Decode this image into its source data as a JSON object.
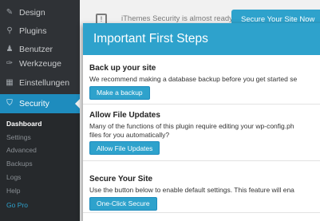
{
  "sidebar": {
    "items": [
      {
        "label": "Design",
        "icon": "paintbrush-icon"
      },
      {
        "label": "Plugins",
        "icon": "plugin-icon"
      },
      {
        "label": "Benutzer",
        "icon": "users-icon"
      },
      {
        "label": "Werkzeuge",
        "icon": "wrench-icon"
      },
      {
        "label": "Einstellungen",
        "icon": "settings-icon"
      }
    ],
    "active": {
      "label": "Security",
      "icon": "shield-icon"
    },
    "submenu": [
      "Dashboard",
      "Settings",
      "Advanced",
      "Backups",
      "Logs",
      "Help",
      "Go Pro"
    ]
  },
  "background": {
    "notice_text": "iThemes Security is almost ready.",
    "notice_button": "Secure Your Site Now"
  },
  "modal": {
    "title": "Important First Steps",
    "sections": [
      {
        "heading": "Back up your site",
        "text": "We recommend making a database backup before you get started se",
        "button": "Make a backup"
      },
      {
        "heading": "Allow File Updates",
        "text": "Many of the functions of this plugin require editing your wp-config.ph",
        "text2": "files for you automatically?",
        "button": "Allow File Updates"
      },
      {
        "heading": "Secure Your Site",
        "text": "Use the button below to enable default settings. This feature will ena",
        "button": "One-Click Secure"
      }
    ]
  },
  "colors": {
    "accent": "#2ea2cc",
    "sidebar": "#2f3236",
    "active": "#1e8cbe"
  }
}
